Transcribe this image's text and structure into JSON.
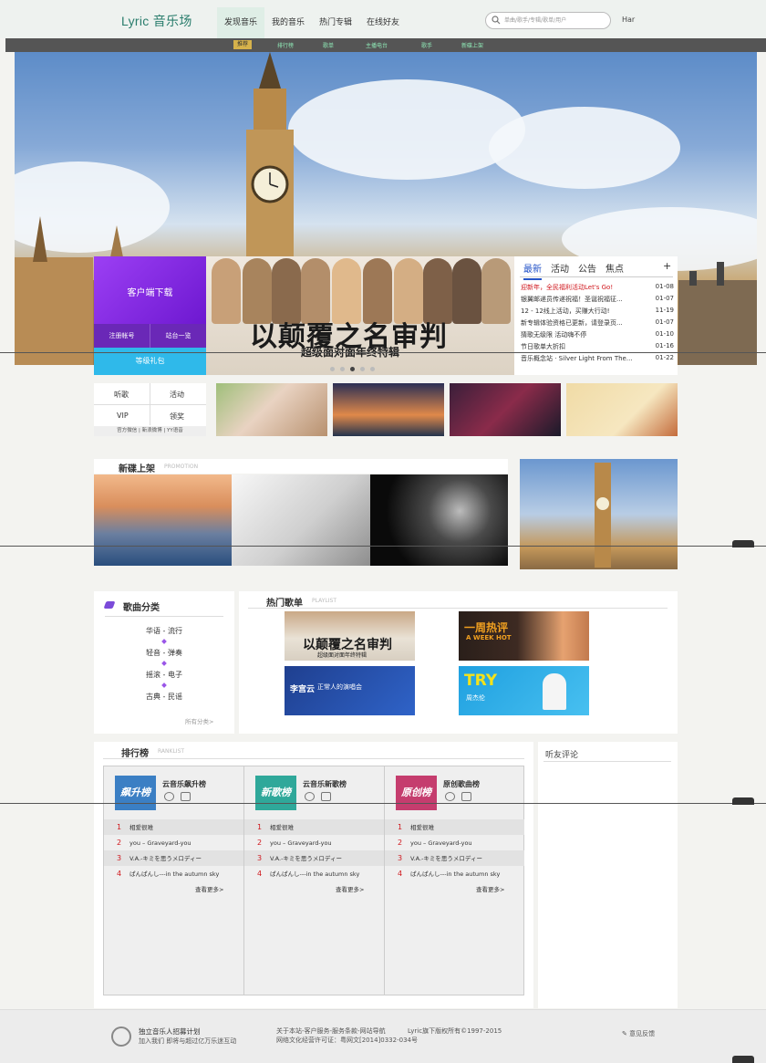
{
  "app": {
    "logo": "Lyric 音乐场",
    "top_right": "Har"
  },
  "main_nav": [
    "发现音乐",
    "我的音乐",
    "热门专辑",
    "在线好友"
  ],
  "search": {
    "placeholder": "单曲/歌手/专辑/歌单/用户"
  },
  "sub_nav": [
    "推荐",
    "排行榜",
    "歌单",
    "主播电台",
    "歌手",
    "新碟上架"
  ],
  "side_panel": {
    "download": "客户端下载",
    "register": "注册帐号",
    "site_list": "站台一览",
    "vip_gift": "等级礼包"
  },
  "banner": {
    "title": "以颠覆之名审判",
    "subtitle": "超级面对面年终特辑"
  },
  "news": {
    "tabs": [
      "最新",
      "活动",
      "公告",
      "焦点"
    ],
    "plus": "+",
    "items": [
      {
        "title": "迎新年，全民福利活动Let's Go!",
        "date": "01-08"
      },
      {
        "title": "银翼邮递员传递祝福！圣诞祝福征...",
        "date": "01-07"
      },
      {
        "title": "12 - 12线上活动，买赚大行动!",
        "date": "11-19"
      },
      {
        "title": "新专辑体验资格已更新，请登录页...",
        "date": "01-07"
      },
      {
        "title": "猜歌无级限 活动嗨不停",
        "date": "01-10"
      },
      {
        "title": "节日歌单大折扣",
        "date": "01-16"
      },
      {
        "title": "音乐概念站 · Silver Light From The...",
        "date": "01-22"
      }
    ]
  },
  "quick_links": {
    "listen": "听歌",
    "events": "活动",
    "vip": "VIP",
    "claim": "领奖",
    "footer_links": "官方微信 | 新浪微博 | YY语音"
  },
  "new_albums": {
    "title": "新碟上架",
    "subtitle": "PROMOTION"
  },
  "categories": {
    "title": "歌曲分类",
    "items": [
      "华语 - 流行",
      "轻音 - 弹奏",
      "摇滚 - 电子",
      "古典 - 民谣"
    ],
    "more": "所有分类>"
  },
  "playlists": {
    "title": "热门歌单",
    "subtitle": "PLAYLIST",
    "covers": [
      {
        "main": "以颠覆之名审判",
        "sub": "超级面对面年终特辑"
      },
      {
        "main": "一周热评",
        "sub": "A WEEK HOT"
      },
      {
        "main": "李宫云",
        "sub": "正常人的演唱会"
      },
      {
        "main": "TRY",
        "sub": "周杰伦"
      }
    ]
  },
  "ranking": {
    "title": "排行榜",
    "subtitle": "RANKLIST",
    "more": "查看更多>",
    "boards": [
      {
        "name": "云音乐飙升榜",
        "cover": "飙升榜",
        "color": "#3b7fc4"
      },
      {
        "name": "云音乐新歌榜",
        "cover": "新歌榜",
        "color": "#2fa89a"
      },
      {
        "name": "原创歌曲榜",
        "cover": "原创榜",
        "color": "#c53d6e"
      }
    ],
    "songs": [
      {
        "rank": "1",
        "title": "相爱很难"
      },
      {
        "rank": "2",
        "title": "you – Graveyard-you"
      },
      {
        "rank": "3",
        "title": "V.A.-キミを思うメロディー"
      },
      {
        "rank": "4",
        "title": "ぱんぱんし---in the autumn sky"
      }
    ]
  },
  "comments": {
    "title": "听友评论"
  },
  "footer": {
    "plan_title": "独立音乐人招募计划",
    "plan_sub": "加入我们 即将与超过亿万乐迷互动",
    "links": "关于本站-客户服务-服务条款-网站导航",
    "copyright": "Lyric旗下版权所有©1997-2015",
    "license": "网络文化经营许可证：粤网文[2014]0332-034号",
    "feedback": "意见反馈"
  },
  "colors": {
    "brand": "#2a7d6c",
    "accent_purple": "#7b26e0",
    "accent_blue": "#2fb9ea",
    "hot_red": "#d0171d"
  }
}
